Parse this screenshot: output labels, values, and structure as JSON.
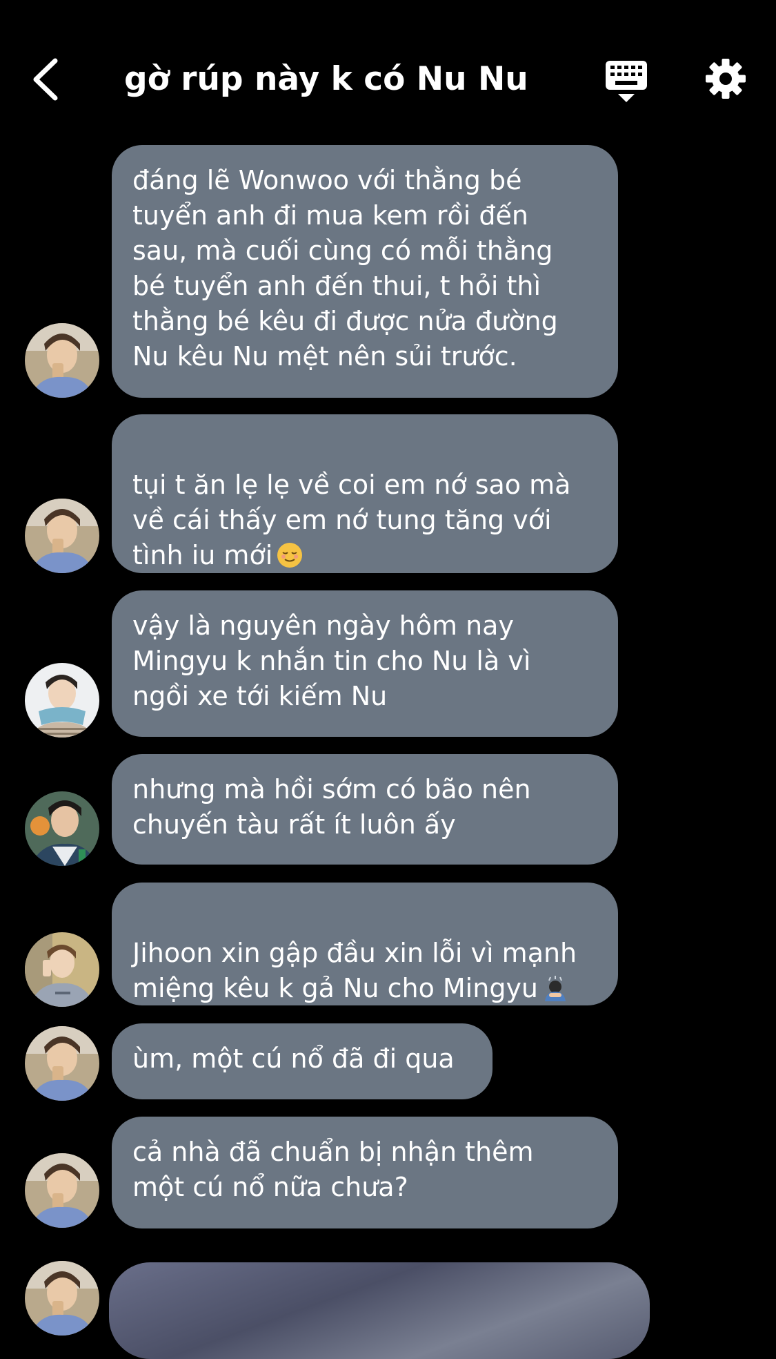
{
  "header": {
    "title": "gờ rúp này k có Nu Nu",
    "back_icon": "chevron-left-icon",
    "keyboard_icon": "keyboard-hide-icon",
    "settings_icon": "gear-icon"
  },
  "colors": {
    "background": "#000000",
    "bubble": "#6b7683",
    "text": "#ffffff"
  },
  "messages": [
    {
      "avatar": "avatar-a",
      "text": "đáng lẽ Wonwoo với thằng bé\ntuyển anh đi mua kem rồi đến\nsau, mà cuối cùng có mỗi thằng\nbé tuyển anh đến thui, t hỏi thì\nthằng bé kêu đi được nửa đường\nNu kêu Nu mệt nên sủi trước."
    },
    {
      "avatar": "avatar-a",
      "text": "tụi t ăn lẹ lẹ về coi em nớ sao mà\nvề cái thấy em nớ tung tăng với\ntình iu mới",
      "emoji": "relieved-face-emoji"
    },
    {
      "avatar": "avatar-b",
      "text": "vậy là nguyên ngày hôm nay\nMingyu k nhắn tin cho Nu là vì\nngồi xe tới kiếm Nu"
    },
    {
      "avatar": "avatar-c",
      "text": "nhưng mà hồi sớm có bão nên\nchuyến tàu rất ít luôn ấy"
    },
    {
      "avatar": "avatar-d",
      "text": "Jihoon xin gập đầu xin lỗi vì mạnh\nmiệng kêu k gả Nu cho Mingyu",
      "emoji": "person-bowing-emoji"
    },
    {
      "avatar": "avatar-a",
      "text": "ùm, một cú nổ đã đi qua"
    },
    {
      "avatar": "avatar-a",
      "text": "cả nhà đã chuẩn bị nhận thêm\nmột cú nổ nữa chưa?"
    }
  ]
}
